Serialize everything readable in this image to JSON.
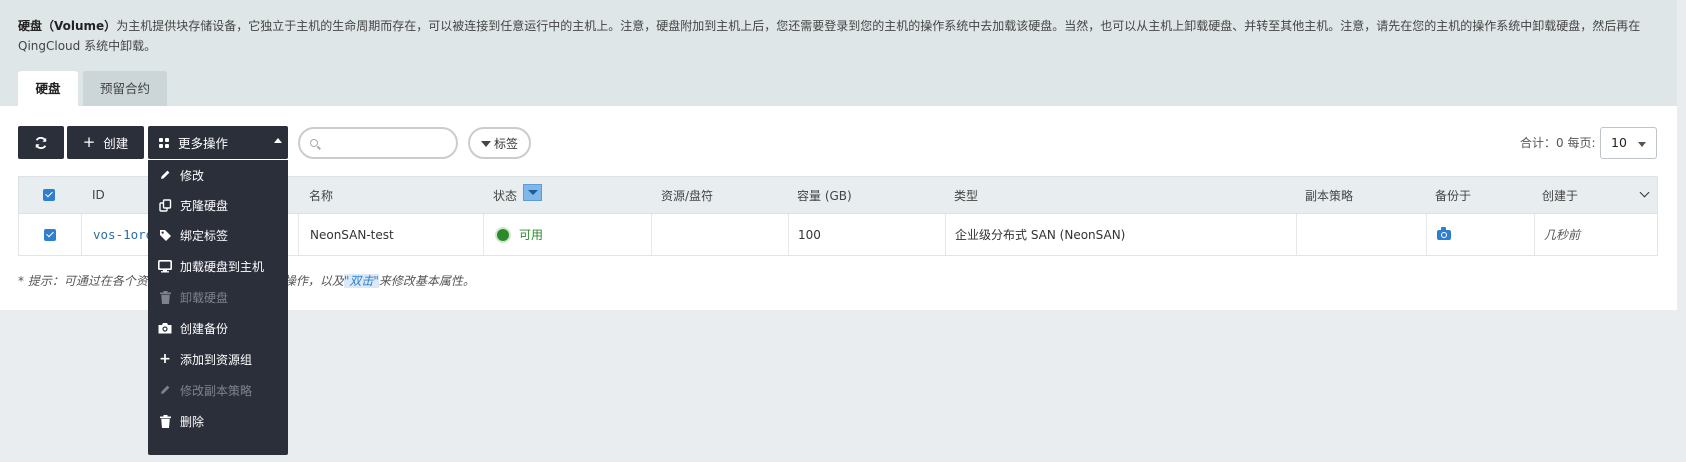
{
  "intro": {
    "title": "硬盘（Volume）",
    "text": "为主机提供块存储设备，它独立于主机的生命周期而存在，可以被连接到任意运行中的主机上。注意，硬盘附加到主机上后，您还需要登录到您的主机的操作系统中去加载该硬盘。当然，也可以从主机上卸载硬盘、并转至其他主机。注意，请先在您的主机的操作系统中卸载硬盘，然后再在 QingCloud 系统中卸载。"
  },
  "tabs": [
    {
      "label": "硬盘",
      "active": true
    },
    {
      "label": "预留合约",
      "active": false
    }
  ],
  "toolbar": {
    "refresh_icon": "refresh-icon",
    "create_label": "创建",
    "more_label": "更多操作",
    "search_placeholder": "",
    "tag_label": "标签",
    "summary": "合计：0  每页:",
    "page_size": "10"
  },
  "menu": {
    "items": [
      {
        "label": "修改",
        "icon": "pencil-icon",
        "disabled": false
      },
      {
        "label": "克隆硬盘",
        "icon": "clone-icon",
        "disabled": false
      },
      {
        "label": "绑定标签",
        "icon": "tag-icon",
        "disabled": false
      },
      {
        "label": "加载硬盘到主机",
        "icon": "monitor-icon",
        "disabled": false
      },
      {
        "label": "卸载硬盘",
        "icon": "trash-icon",
        "disabled": true
      },
      {
        "label": "创建备份",
        "icon": "camera-icon",
        "disabled": false
      },
      {
        "label": "添加到资源组",
        "icon": "plus-icon",
        "disabled": false
      },
      {
        "label": "修改副本策略",
        "icon": "pencil-icon",
        "disabled": true
      },
      {
        "label": "删除",
        "icon": "trash-icon",
        "disabled": false
      }
    ]
  },
  "table": {
    "headers": [
      "ID",
      "名称",
      "状态",
      "资源/盘符",
      "容量 (GB)",
      "类型",
      "副本策略",
      "备份于",
      "创建于"
    ],
    "rows": [
      {
        "id": "vos-1ore",
        "name": "NeonSAN-test",
        "status": "可用",
        "resource": "",
        "capacity": "100",
        "type": "企业级分布式 SAN (NeonSAN)",
        "replica": "",
        "backup_icon": "camera-icon",
        "created": "几秒前"
      }
    ]
  },
  "hint": {
    "prefix": "* 提示：可通过在各个资",
    "middle": "操作，以及",
    "highlight": "\"双击\"",
    "suffix": "来修改基本属性。"
  },
  "colors": {
    "dark": "#2b2f3a",
    "accent": "#2f7fd0",
    "status_green": "#2c8a2c"
  }
}
